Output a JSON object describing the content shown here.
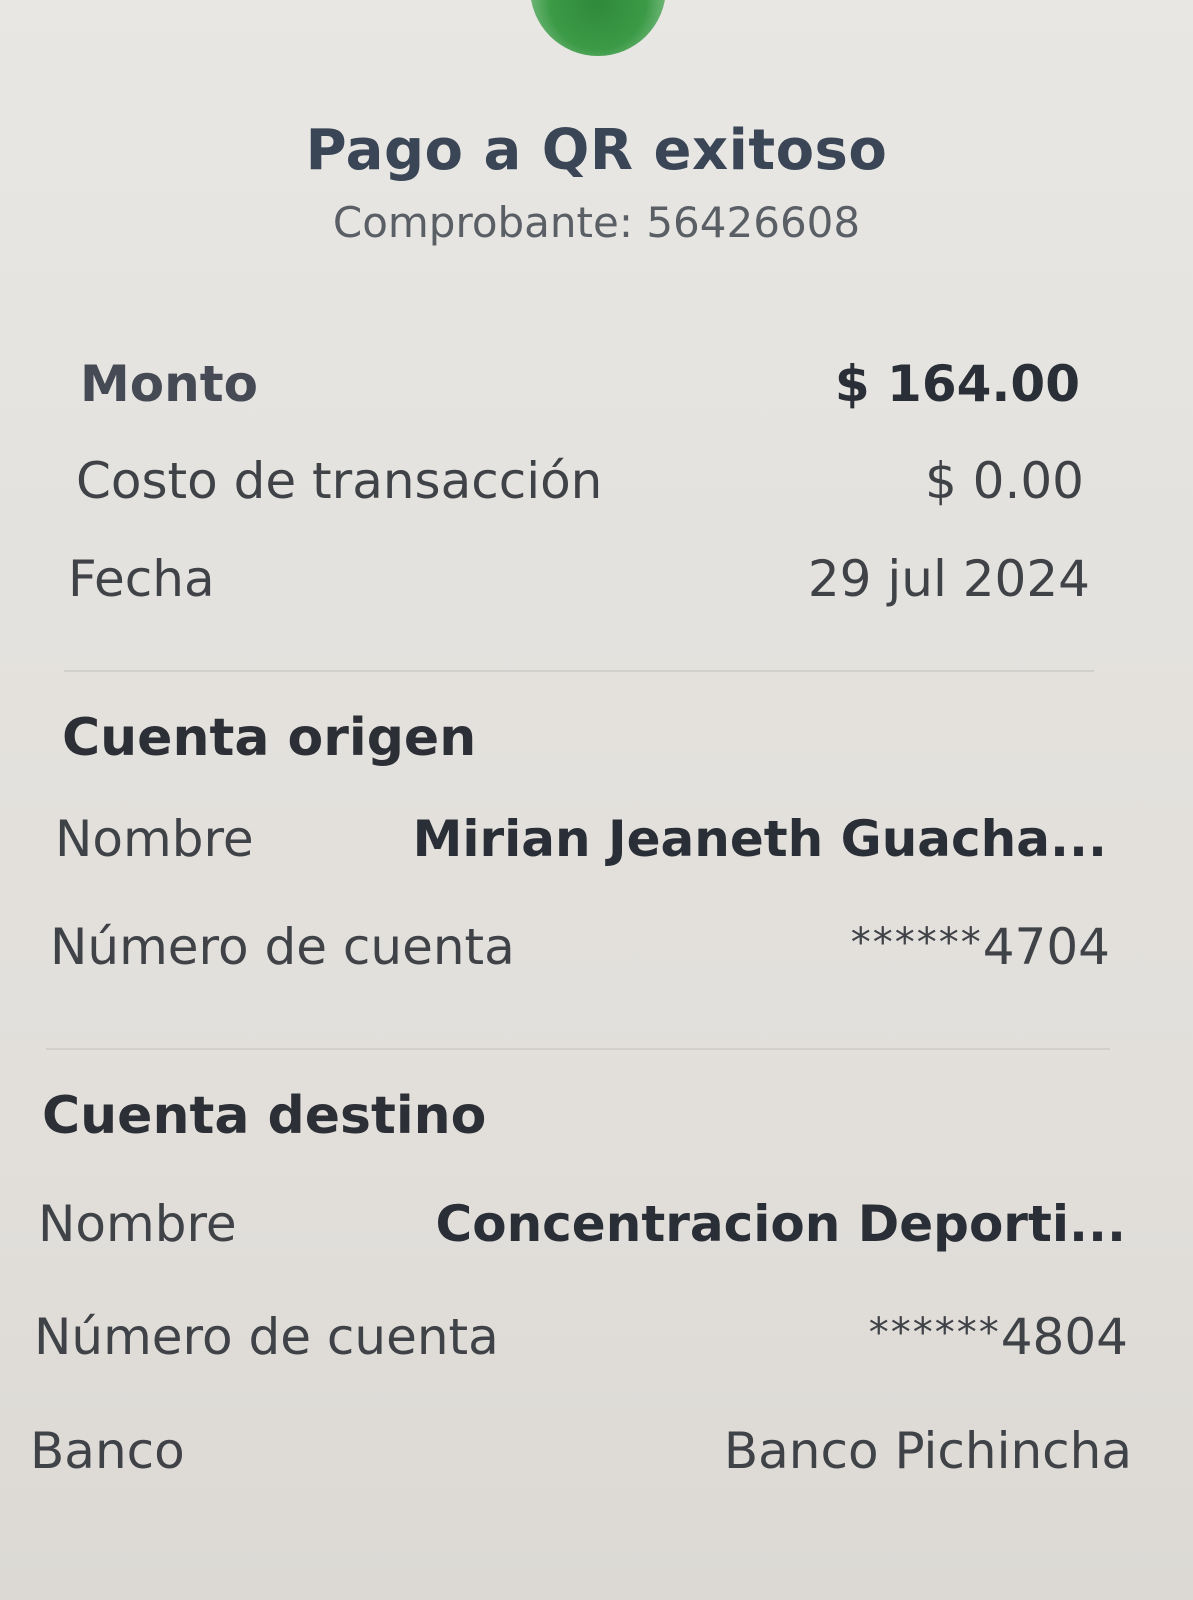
{
  "header": {
    "title": "Pago a QR exitoso",
    "receipt": "Comprobante: 56426608"
  },
  "summary": {
    "amount_label": "Monto",
    "amount_value": "$ 164.00",
    "fee_label": "Costo de transacción",
    "fee_value": "$ 0.00",
    "date_label": "Fecha",
    "date_value": "29 jul 2024"
  },
  "origin": {
    "title": "Cuenta origen",
    "name_label": "Nombre",
    "name_value": "Mirian Jeaneth Guacha...",
    "account_label": "Número de cuenta",
    "account_mask": "******",
    "account_last": "4704"
  },
  "destination": {
    "title": "Cuenta destino",
    "name_label": "Nombre",
    "name_value": "Concentracion Deporti...",
    "account_label": "Número de cuenta",
    "account_mask": "******",
    "account_last": "4804",
    "bank_label": "Banco",
    "bank_value": "Banco Pichincha"
  },
  "icons": {
    "status": "success-check-icon"
  },
  "colors": {
    "success": "#3b9a46",
    "title": "#3a4656"
  }
}
